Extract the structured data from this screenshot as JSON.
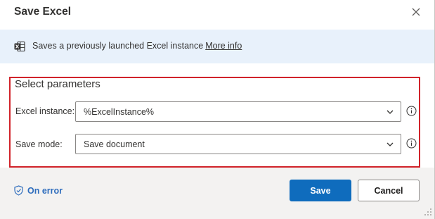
{
  "dialog": {
    "title": "Save Excel",
    "close_icon": "close-icon"
  },
  "info_bar": {
    "icon": "excel-icon",
    "text": "Saves a previously launched Excel instance",
    "link": "More info"
  },
  "parameters": {
    "heading": "Select parameters",
    "excel_instance": {
      "label": "Excel instance:",
      "value": "%ExcelInstance%"
    },
    "save_mode": {
      "label": "Save mode:",
      "value": "Save document"
    }
  },
  "footer": {
    "on_error": "On error",
    "save_label": "Save",
    "cancel_label": "Cancel"
  },
  "colors": {
    "accent": "#0f6cbd",
    "highlight_border": "#d1232a",
    "info_bar_bg": "#e8f1fb"
  }
}
